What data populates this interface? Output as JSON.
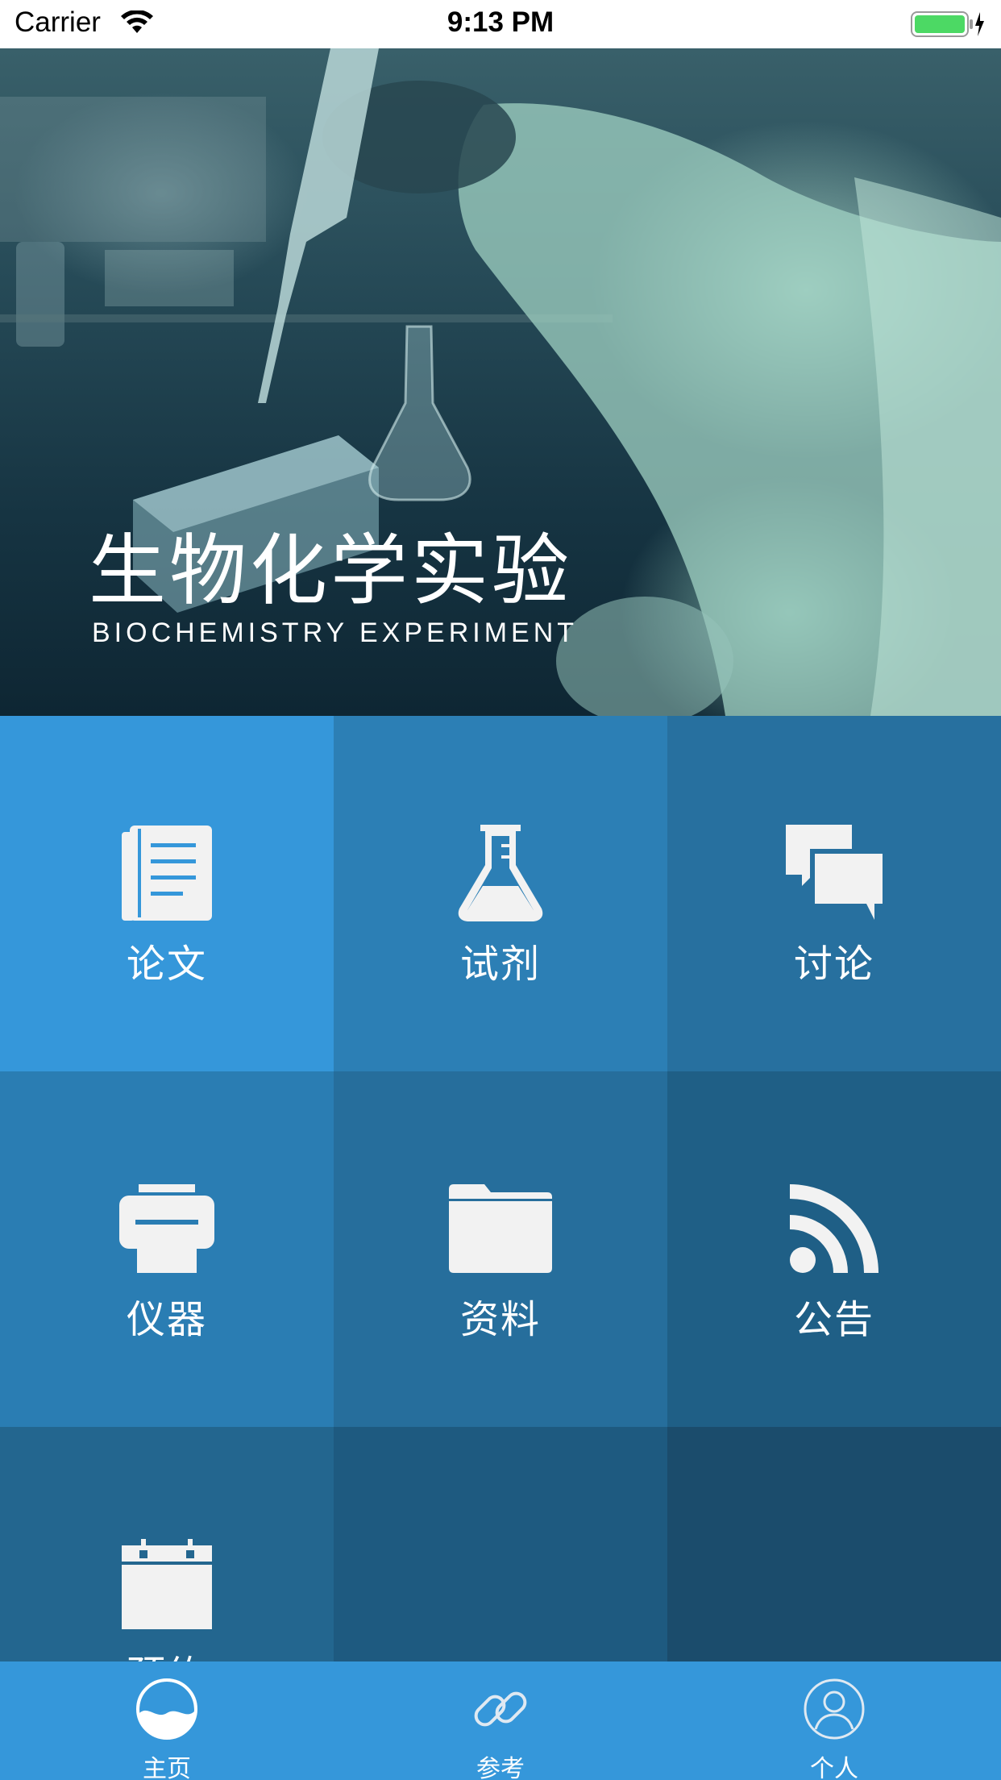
{
  "status_bar": {
    "carrier": "Carrier",
    "time": "9:13 PM",
    "battery_color": "#4cd964"
  },
  "banner": {
    "title": "生物化学实验",
    "subtitle": "BIOCHEMISTRY EXPERIMENT"
  },
  "tiles": [
    {
      "label": "论文",
      "icon": "document-icon",
      "color": "#3597da"
    },
    {
      "label": "试剂",
      "icon": "flask-icon",
      "color": "#2c7fb5"
    },
    {
      "label": "讨论",
      "icon": "chat-bubbles-icon",
      "color": "#27709f"
    },
    {
      "label": "仪器",
      "icon": "printer-icon",
      "color": "#2a7db3"
    },
    {
      "label": "资料",
      "icon": "folder-icon",
      "color": "#266e9c"
    },
    {
      "label": "公告",
      "icon": "rss-icon",
      "color": "#1f5f86"
    },
    {
      "label": "预约",
      "icon": "calendar-icon",
      "color": "#23668f"
    },
    {
      "label": "",
      "icon": "",
      "color": "#1e5a80"
    },
    {
      "label": "",
      "icon": "",
      "color": "#1b4c6c"
    }
  ],
  "tab_bar": {
    "color": "#3597da",
    "tabs": [
      {
        "label": "主页",
        "icon": "home-wave-icon"
      },
      {
        "label": "参考",
        "icon": "link-icon"
      },
      {
        "label": "个人",
        "icon": "user-icon"
      }
    ]
  }
}
